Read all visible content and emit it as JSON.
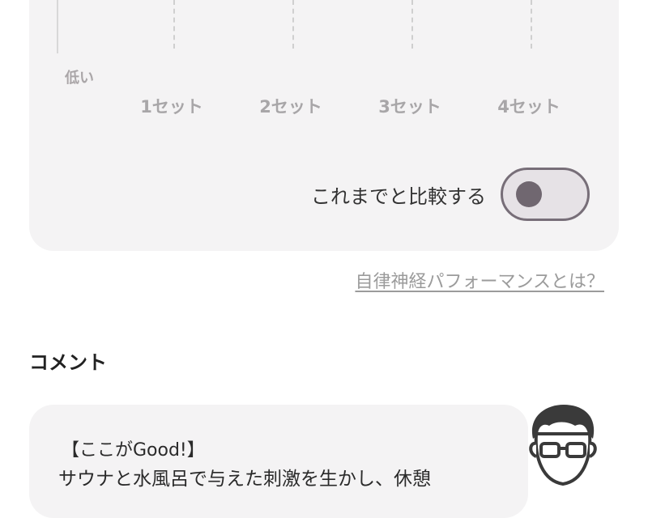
{
  "chart": {
    "y_low_label": "低い",
    "x_ticks": [
      "1セット",
      "2セット",
      "3セット",
      "4セット"
    ]
  },
  "compare": {
    "label": "これまでと比較する",
    "toggle_on": false
  },
  "about_link": "自律神経パフォーマンスとは？",
  "comment_section": {
    "title": "コメント",
    "heading": "【ここがGood!】",
    "body": "サウナと水風呂で与えた刺激を生かし、休憩"
  },
  "icons": {
    "avatar": "man-with-glasses-avatar-icon"
  }
}
